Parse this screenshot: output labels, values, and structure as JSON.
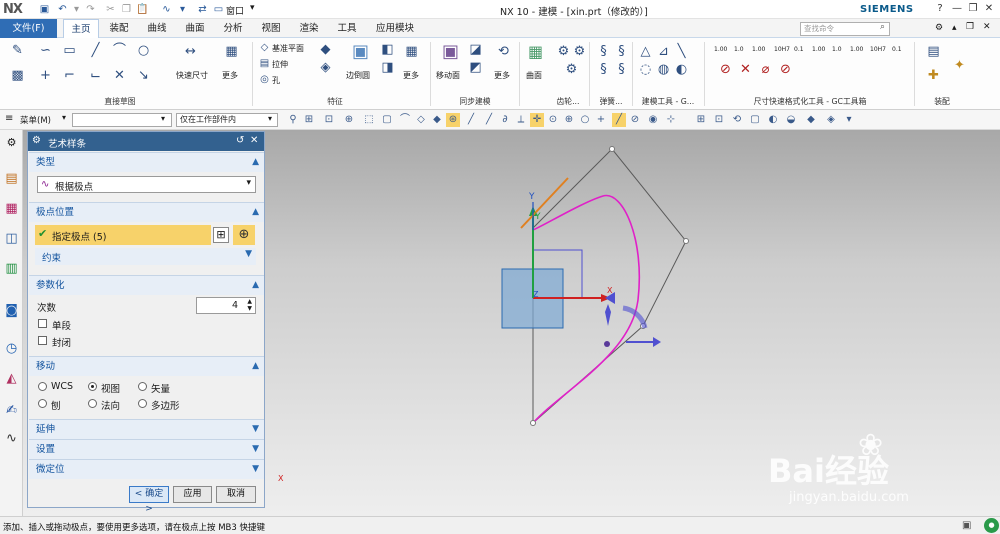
{
  "title": {
    "logo": "NX",
    "window": "NX 10 - 建模 - [xin.prt（修改的）]",
    "brand": "SIEMENS",
    "window_menu": "窗口",
    "quick_access": [
      "save-icon",
      "undo-icon",
      "redo-icon",
      "cut-icon",
      "copy-icon",
      "paste-icon",
      "spline-icon"
    ],
    "controls": [
      "?",
      "—",
      "□",
      "✕"
    ]
  },
  "tabs": {
    "file": "文件(F)",
    "items": [
      "主页",
      "装配",
      "曲线",
      "曲面",
      "分析",
      "视图",
      "渲染",
      "工具",
      "应用模块"
    ],
    "active_index": 0,
    "search_placeholder": "查找命令"
  },
  "ribbon": {
    "groups": [
      "直接草图",
      "特征",
      "同步建模",
      "齿轮...",
      "弹簧...",
      "建模工具 - G...",
      "尺寸快速格式化工具 - GC工具箱",
      "装配"
    ],
    "buttons": {
      "quick_dim": "快速尺寸",
      "more": "更多",
      "datum_plane": "基准平面",
      "extrude": "拉伸",
      "hole": "孔",
      "edge_blend": "边倒圆",
      "move_face": "移动面",
      "surface": "曲面"
    },
    "dim_labels": [
      "1.00",
      "1.0",
      "1.00",
      "10H7",
      "0.1",
      "1.00",
      "1.0",
      "1.00",
      "10H7",
      "0.1"
    ]
  },
  "cmdbar": {
    "menu": "菜单(M)",
    "filter": "",
    "scope": "仅在工作部件内"
  },
  "dialog": {
    "title": "艺术样条",
    "type": {
      "header": "类型",
      "value": "根据极点"
    },
    "pole": {
      "header": "极点位置",
      "specify": "指定极点 (5)",
      "constraint": "约束"
    },
    "param": {
      "header": "参数化",
      "degree_label": "次数",
      "degree_value": "4",
      "single_segment": "单段",
      "closed": "封闭"
    },
    "move": {
      "header": "移动",
      "options": [
        "WCS",
        "视图",
        "矢量",
        "刨",
        "法向",
        "多边形"
      ],
      "selected": "视图"
    },
    "extend": "延伸",
    "settings": "设置",
    "fine": "微定位",
    "buttons": {
      "ok": "< 确定 >",
      "apply": "应用",
      "cancel": "取消"
    }
  },
  "view": {
    "axis_x": "X",
    "axis_y": "Y",
    "axis_z": "Z",
    "wcs_x": "X",
    "wcs_y": "Y"
  },
  "status": "添加、插入或拖动极点，要使用更多选项，请在极点上按 MB3 快捷键",
  "watermark": {
    "text": "Bai经验",
    "url": "jingyan.baidu.com"
  },
  "colors": {
    "accent": "#2f6db5",
    "spline": "#e020c8",
    "dialog_header": "#33618f",
    "section_text": "#12539e",
    "highlight": "#f7d26a"
  }
}
